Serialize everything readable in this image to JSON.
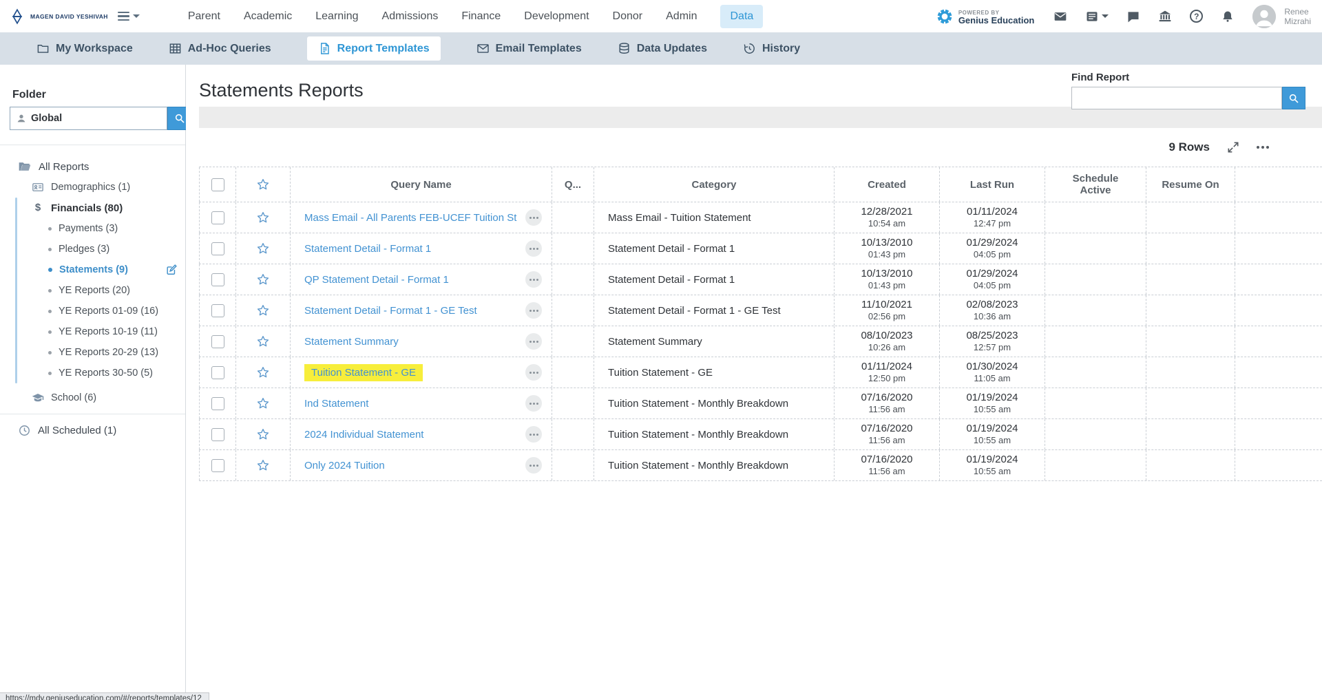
{
  "topnav": {
    "logo_text": "MAGEN DAVID YESHIVAH",
    "nav_items": [
      "Parent",
      "Academic",
      "Learning",
      "Admissions",
      "Finance",
      "Development",
      "Donor",
      "Admin",
      "Data"
    ],
    "active_nav": "Data",
    "powered_by_line1": "POWERED BY",
    "powered_by_line2": "Genius Education",
    "user_first": "Renee",
    "user_last": "Mizrahi"
  },
  "subnav": {
    "items": [
      "My Workspace",
      "Ad-Hoc Queries",
      "Report Templates",
      "Email Templates",
      "Data Updates",
      "History"
    ],
    "active": "Report Templates"
  },
  "sidebar": {
    "folder_label": "Folder",
    "search_value": "Global",
    "all_reports": "All Reports",
    "demographics": "Demographics (1)",
    "financials": "Financials (80)",
    "financials_children": [
      "Payments (3)",
      "Pledges (3)",
      "Statements (9)",
      "YE Reports (20)",
      "YE Reports 01-09 (16)",
      "YE Reports 10-19 (11)",
      "YE Reports 20-29 (13)",
      "YE Reports 30-50 (5)"
    ],
    "selected_child": "Statements (9)",
    "school": "School (6)",
    "all_scheduled": "All Scheduled (1)"
  },
  "main": {
    "title": "Statements Reports",
    "find_report_label": "Find Report",
    "find_report_value": "",
    "rows_count_label": "9 Rows",
    "columns": {
      "query_name": "Query Name",
      "q": "Q...",
      "category": "Category",
      "created": "Created",
      "last_run": "Last Run",
      "schedule_active": "Schedule Active",
      "resume_on": "Resume On"
    },
    "rows": [
      {
        "query_name": "Mass Email - All Parents FEB-UCEF Tuition St",
        "category": "Mass Email - Tuition Statement",
        "created_date": "12/28/2021",
        "created_time": "10:54 am",
        "run_date": "01/11/2024",
        "run_time": "12:47 pm",
        "highlight": false
      },
      {
        "query_name": "Statement Detail - Format 1",
        "category": "Statement Detail - Format 1",
        "created_date": "10/13/2010",
        "created_time": "01:43 pm",
        "run_date": "01/29/2024",
        "run_time": "04:05 pm",
        "highlight": false
      },
      {
        "query_name": "QP Statement Detail - Format 1",
        "category": "Statement Detail - Format 1",
        "created_date": "10/13/2010",
        "created_time": "01:43 pm",
        "run_date": "01/29/2024",
        "run_time": "04:05 pm",
        "highlight": false
      },
      {
        "query_name": "Statement Detail - Format 1 - GE Test",
        "category": "Statement Detail - Format 1 - GE Test",
        "created_date": "11/10/2021",
        "created_time": "02:56 pm",
        "run_date": "02/08/2023",
        "run_time": "10:36 am",
        "highlight": false
      },
      {
        "query_name": "Statement Summary",
        "category": "Statement Summary",
        "created_date": "08/10/2023",
        "created_time": "10:26 am",
        "run_date": "08/25/2023",
        "run_time": "12:57 pm",
        "highlight": false
      },
      {
        "query_name": "Tuition Statement - GE",
        "category": "Tuition Statement - GE",
        "created_date": "01/11/2024",
        "created_time": "12:50 pm",
        "run_date": "01/30/2024",
        "run_time": "11:05 am",
        "highlight": true
      },
      {
        "query_name": "Ind Statement",
        "category": "Tuition Statement - Monthly Breakdown",
        "created_date": "07/16/2020",
        "created_time": "11:56 am",
        "run_date": "01/19/2024",
        "run_time": "10:55 am",
        "highlight": false
      },
      {
        "query_name": "2024 Individual Statement",
        "category": "Tuition Statement - Monthly Breakdown",
        "created_date": "07/16/2020",
        "created_time": "11:56 am",
        "run_date": "01/19/2024",
        "run_time": "10:55 am",
        "highlight": false
      },
      {
        "query_name": "Only 2024 Tuition",
        "category": "Tuition Statement - Monthly Breakdown",
        "created_date": "07/16/2020",
        "created_time": "11:56 am",
        "run_date": "01/19/2024",
        "run_time": "10:55 am",
        "highlight": false
      }
    ]
  },
  "status_url": "https://mdy.geniuseducation.com/#/reports/templates/12",
  "colors": {
    "accent_blue": "#2e96d5",
    "link_blue": "#4292d2",
    "highlight_yellow": "#f7ee3b",
    "subnav_bg": "#d7dfe7"
  }
}
